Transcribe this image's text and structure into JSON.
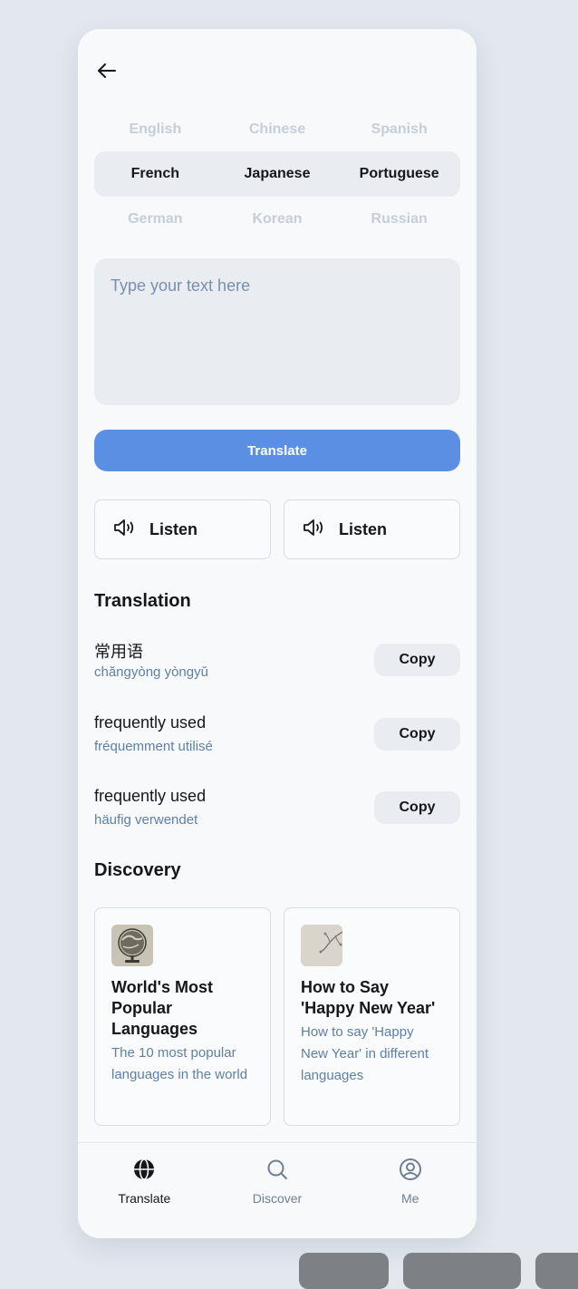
{
  "languages": {
    "row1": [
      "English",
      "Chinese",
      "Spanish"
    ],
    "row2": [
      "French",
      "Japanese",
      "Portuguese"
    ],
    "row3": [
      "German",
      "Korean",
      "Russian"
    ]
  },
  "input": {
    "placeholder": "Type your text here"
  },
  "translate_button": "Translate",
  "listen_buttons": [
    "Listen",
    "Listen"
  ],
  "translation": {
    "title": "Translation",
    "items": [
      {
        "text": "常用语",
        "sub": "chăngyòng yòngyǔ",
        "copy": "Copy"
      },
      {
        "text": "frequently used",
        "sub": "fréquemment utilisé",
        "copy": "Copy"
      },
      {
        "text": "frequently used",
        "sub": "häufig verwendet",
        "copy": "Copy"
      }
    ]
  },
  "discovery": {
    "title": "Discovery",
    "cards": [
      {
        "title": "World's Most Popular Languages",
        "desc": "The 10 most popular languages in the world",
        "icon": "globe-thumbnail"
      },
      {
        "title": "How to Say 'Happy New Year'",
        "desc": "How to say 'Happy New Year' in different languages",
        "icon": "branch-thumbnail"
      }
    ]
  },
  "tabs": [
    {
      "label": "Translate",
      "icon": "globe-icon",
      "active": true
    },
    {
      "label": "Discover",
      "icon": "search-icon",
      "active": false
    },
    {
      "label": "Me",
      "icon": "user-icon",
      "active": false
    }
  ],
  "colors": {
    "accent": "#5b8fe3",
    "subtext": "#5e7fa6",
    "inactive_lang": "#c5ced9"
  }
}
